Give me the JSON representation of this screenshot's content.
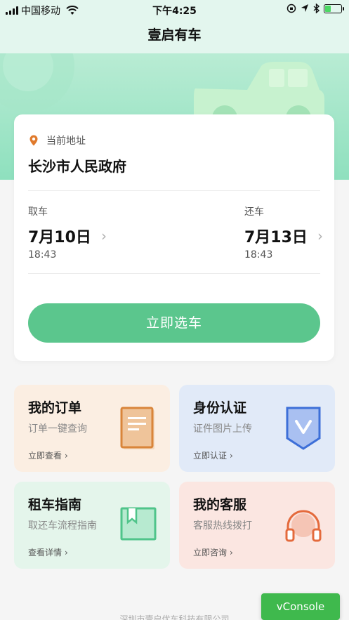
{
  "status_bar": {
    "carrier": "中国移动",
    "time": "下午4:25",
    "battery_level": 0.35
  },
  "nav": {
    "title": "壹启有车"
  },
  "address": {
    "label": "当前地址",
    "value": "长沙市人民政府"
  },
  "pickup": {
    "label": "取车",
    "date": "7月10日",
    "time": "18:43"
  },
  "return": {
    "label": "还车",
    "date": "7月13日",
    "time": "18:43"
  },
  "select_car_button": "立即选车",
  "tiles": [
    {
      "title": "我的订单",
      "subtitle": "订单一键查询",
      "link": "立即查看",
      "icon": "document-icon"
    },
    {
      "title": "身份认证",
      "subtitle": "证件图片上传",
      "link": "立即认证",
      "icon": "shield-check-icon"
    },
    {
      "title": "租车指南",
      "subtitle": "取还车流程指南",
      "link": "查看详情",
      "icon": "book-icon"
    },
    {
      "title": "我的客服",
      "subtitle": "客服热线拨打",
      "link": "立即咨询",
      "icon": "headphones-icon"
    }
  ],
  "footer": "深圳市壹启优车科技有限公司",
  "vconsole": "vConsole",
  "colors": {
    "brand_green": "#5bc68d",
    "banner_green": "#8ee0be",
    "location_orange": "#e07a2c"
  }
}
